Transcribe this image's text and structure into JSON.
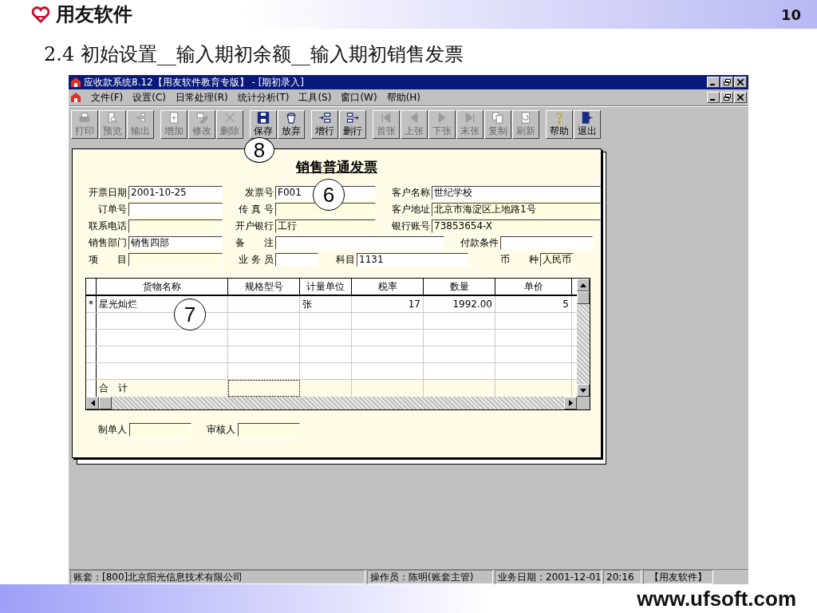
{
  "slide": {
    "brand": "用友软件",
    "page_number": "10",
    "heading": "2.4 初始设置__输入期初余额__输入期初销售发票",
    "footer": "www.ufsoft.com"
  },
  "window": {
    "title": "应收款系统8.12【用友软件教育专版】 - [期初录入]"
  },
  "menu": [
    "文件(F)",
    "设置(C)",
    "日常处理(R)",
    "统计分析(T)",
    "工具(S)",
    "窗口(W)",
    "帮助(H)"
  ],
  "toolbar": [
    [
      {
        "label": "打印",
        "kind": "print",
        "disabled": true
      },
      {
        "label": "预览",
        "kind": "preview",
        "disabled": true
      },
      {
        "label": "输出",
        "kind": "export",
        "disabled": true
      }
    ],
    [
      {
        "label": "增加",
        "kind": "add",
        "disabled": true
      },
      {
        "label": "修改",
        "kind": "edit",
        "disabled": true
      },
      {
        "label": "删除",
        "kind": "delete",
        "disabled": true
      }
    ],
    [
      {
        "label": "保存",
        "kind": "save",
        "disabled": false
      },
      {
        "label": "放弃",
        "kind": "discard",
        "disabled": false
      }
    ],
    [
      {
        "label": "增行",
        "kind": "addrow",
        "disabled": false
      },
      {
        "label": "删行",
        "kind": "delrow",
        "disabled": false
      }
    ],
    [
      {
        "label": "首张",
        "kind": "first",
        "disabled": true
      },
      {
        "label": "上张",
        "kind": "prev",
        "disabled": true
      },
      {
        "label": "下张",
        "kind": "next",
        "disabled": true
      },
      {
        "label": "末张",
        "kind": "last",
        "disabled": true
      },
      {
        "label": "复制",
        "kind": "copy",
        "disabled": true
      },
      {
        "label": "刷新",
        "kind": "refresh",
        "disabled": true
      }
    ],
    [
      {
        "label": "帮助",
        "kind": "help",
        "disabled": false
      },
      {
        "label": "退出",
        "kind": "exit",
        "disabled": false
      }
    ]
  ],
  "form": {
    "title": "销售普通发票",
    "rows": [
      [
        {
          "label": "开票日期",
          "value": "2001-10-25",
          "editable": true
        },
        {
          "label": "发票号",
          "value": "F001",
          "editable": true
        },
        {
          "label": "客户名称",
          "value": "世纪学校",
          "editable": true
        }
      ],
      [
        {
          "label": "订单号",
          "editable": true
        },
        {
          "label": "传 真 号",
          "editable": false
        },
        {
          "label": "客户地址",
          "value": "北京市海淀区上地路1号",
          "editable": false
        }
      ],
      [
        {
          "label": "联系电话",
          "editable": false
        },
        {
          "label": "开户银行",
          "value": "工行",
          "editable": false
        },
        {
          "label": "银行账号",
          "value": "73853654-X",
          "editable": false
        }
      ],
      [
        {
          "label": "销售部门",
          "value": "销售四部",
          "editable": true
        },
        {
          "label": "备　　注",
          "editable": true
        },
        {
          "label": "付款条件",
          "editable": true
        }
      ],
      [
        {
          "label": "项　　目",
          "editable": false
        },
        {
          "label": "业 务 员",
          "editable": true
        },
        {
          "label": "科目",
          "value": "1131",
          "editable": true
        },
        {
          "label": "币　　种",
          "value": "人民币",
          "editable": false
        }
      ]
    ],
    "table": {
      "columns": [
        "货物名称",
        "规格型号",
        "计量单位",
        "税率",
        "数量",
        "单价"
      ],
      "rows": [
        {
          "marker": "*",
          "cells": [
            "星光灿烂",
            "",
            "张",
            "17",
            "1992.00",
            "5"
          ]
        }
      ],
      "total_label": "合　计"
    },
    "signers": [
      {
        "label": "制单人"
      },
      {
        "label": "审核人"
      }
    ]
  },
  "callouts": [
    "8",
    "6",
    "7"
  ],
  "status_bar": [
    "账套：[800]北京阳光信息技术有限公司",
    "操作员：陈明(账套主管)",
    "业务日期：2001-12-01",
    "20:16",
    "【用友软件】"
  ]
}
